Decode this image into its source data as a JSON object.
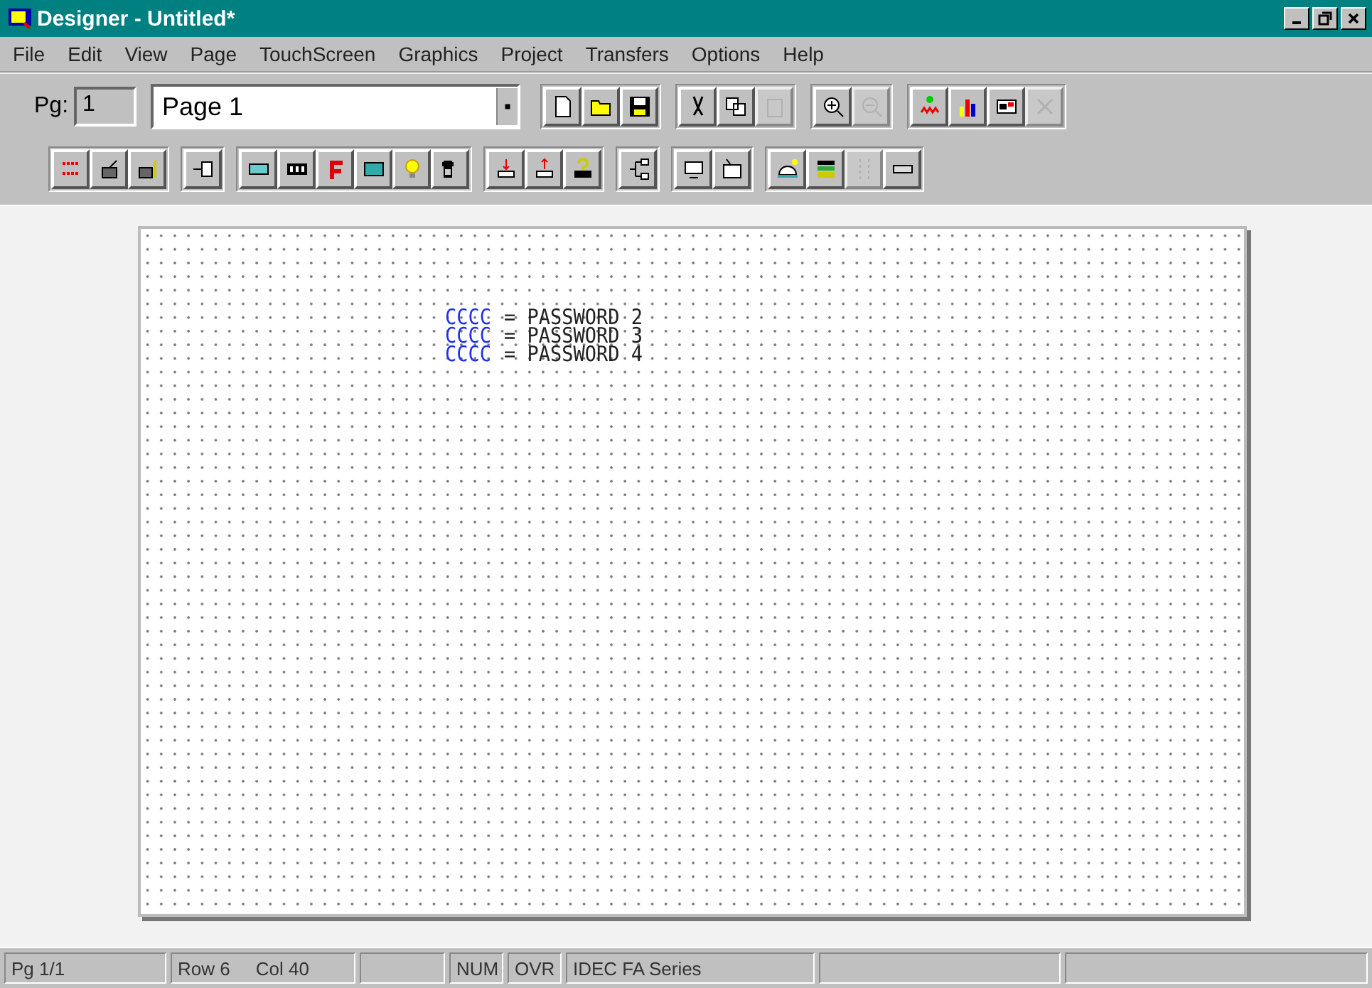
{
  "window": {
    "title": "Designer - Untitled*"
  },
  "menu": [
    "File",
    "Edit",
    "View",
    "Page",
    "TouchScreen",
    "Graphics",
    "Project",
    "Transfers",
    "Options",
    "Help"
  ],
  "page_bar": {
    "label": "Pg:",
    "number": "1",
    "page_name": "Page 1"
  },
  "toolbar_1": [
    [
      {
        "disabled": false
      },
      {
        "disabled": false
      },
      {
        "disabled": false
      }
    ],
    [
      {
        "disabled": false
      },
      {
        "disabled": false
      },
      {
        "disabled": true
      }
    ],
    [
      {
        "disabled": false
      },
      {
        "disabled": true
      }
    ],
    [
      {
        "disabled": false
      },
      {
        "disabled": false
      },
      {
        "disabled": false
      },
      {
        "disabled": true
      }
    ]
  ],
  "toolbar_2": [
    [
      {
        "disabled": false
      },
      {
        "disabled": false
      },
      {
        "disabled": false
      }
    ],
    [
      {
        "disabled": false
      }
    ],
    [
      {
        "disabled": false
      },
      {
        "disabled": false
      },
      {
        "disabled": false
      },
      {
        "disabled": false
      },
      {
        "disabled": false
      },
      {
        "disabled": false
      }
    ],
    [
      {
        "disabled": false
      },
      {
        "disabled": false
      },
      {
        "disabled": false
      }
    ],
    [
      {
        "disabled": false
      }
    ],
    [
      {
        "disabled": false
      },
      {
        "disabled": false
      }
    ],
    [
      {
        "disabled": false
      },
      {
        "disabled": false
      },
      {
        "disabled": true
      },
      {
        "disabled": false
      }
    ]
  ],
  "canvas": {
    "lines": [
      {
        "tag": "CCCC",
        "text": "= PASSWORD 2"
      },
      {
        "tag": "CCCC",
        "text": "= PASSWORD 3"
      },
      {
        "tag": "CCCC",
        "text": "= PASSWORD 4"
      }
    ]
  },
  "status_bar": {
    "page": "Pg 1/1",
    "row": "Row 6",
    "col": "Col 40",
    "num": "NUM",
    "ovr": "OVR",
    "series": "IDEC FA Series"
  }
}
